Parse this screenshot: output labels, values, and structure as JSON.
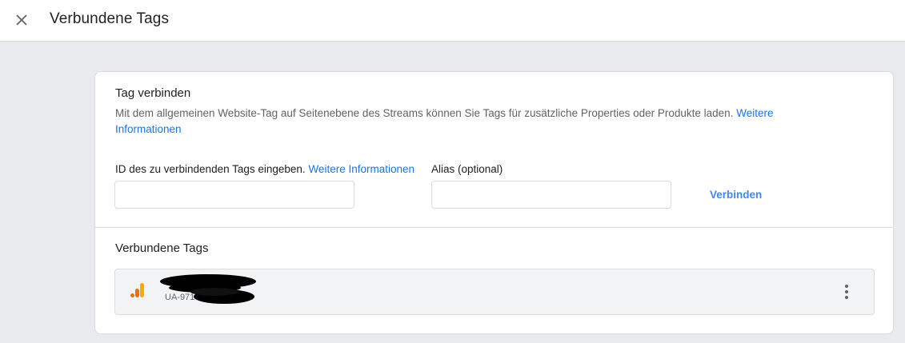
{
  "header": {
    "title": "Verbundene Tags",
    "close_icon": "close-icon"
  },
  "connect_section": {
    "title": "Tag verbinden",
    "description": "Mit dem allgemeinen Website-Tag auf Seitenebene des Streams können Sie Tags für zusätzliche Properties oder Produkte laden. ",
    "description_link": "Weitere Informationen",
    "id_label": "ID des zu verbindenden Tags eingeben. ",
    "id_label_link": "Weitere Informationen",
    "id_input_value": "",
    "alias_label": "Alias (optional)",
    "alias_input_value": "",
    "connect_button": "Verbinden"
  },
  "connected_section": {
    "title": "Verbundene Tags",
    "tags": [
      {
        "name": "",
        "id": "UA-971",
        "icon": "google-analytics-icon"
      }
    ]
  },
  "colors": {
    "link": "#1a73e8",
    "button": "#4285f4",
    "ga_orange_dark": "#e37400",
    "ga_orange_light": "#f9ab00"
  }
}
